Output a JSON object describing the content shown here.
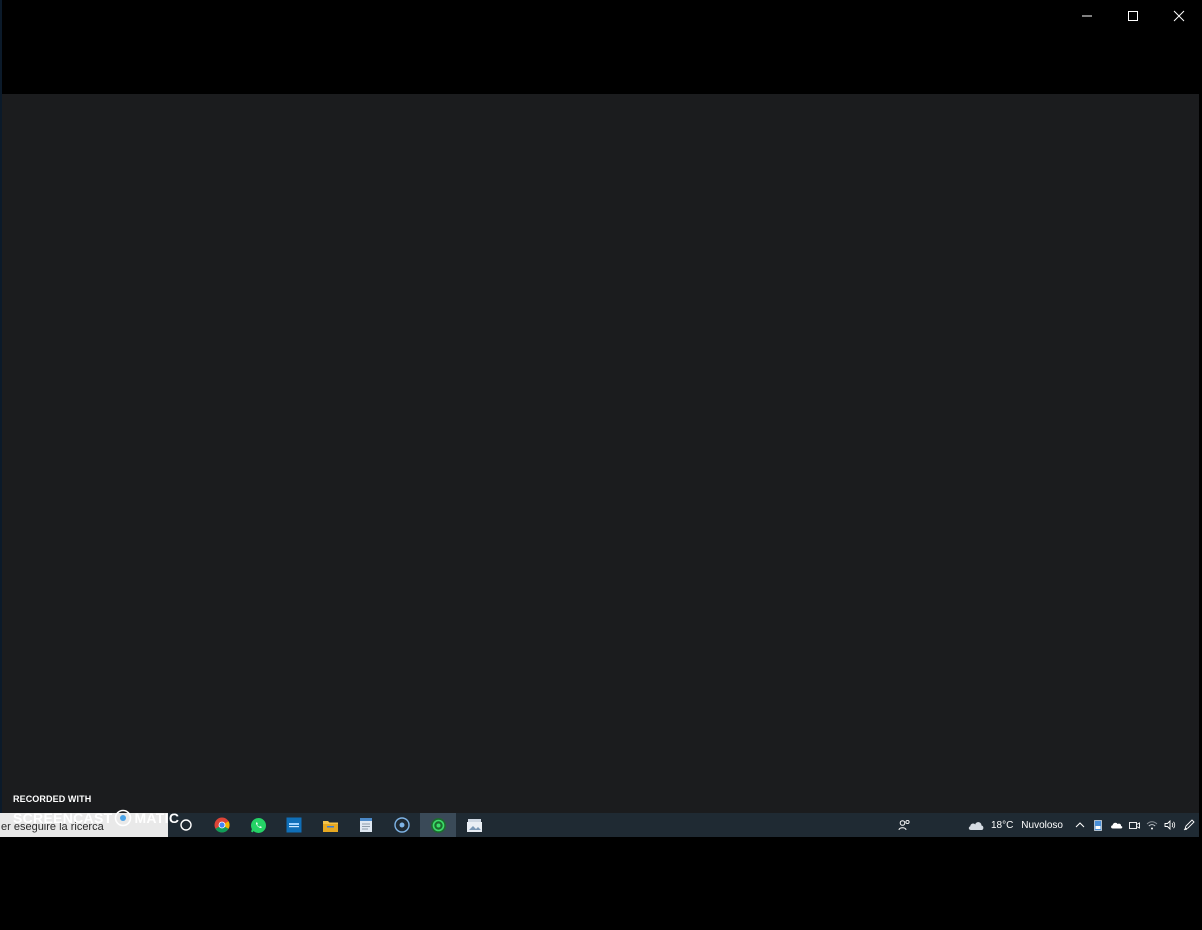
{
  "window": {
    "controls": {
      "minimize_icon": "minimize-icon",
      "maximize_icon": "maximize-icon",
      "close_icon": "close-icon"
    }
  },
  "watermark": {
    "line1": "RECORDED WITH",
    "brand_left": "SCREENCAST",
    "brand_right": "MATIC"
  },
  "taskbar": {
    "search_text": "er eseguire la ricerca",
    "apps": [
      {
        "name": "cortana-icon"
      },
      {
        "name": "chrome-icon"
      },
      {
        "name": "whatsapp-icon"
      },
      {
        "name": "intel-graphics-icon"
      },
      {
        "name": "file-explorer-icon"
      },
      {
        "name": "notepad-icon"
      },
      {
        "name": "screencast-o-matic-icon"
      },
      {
        "name": "recording-app-icon"
      },
      {
        "name": "photos-icon"
      }
    ],
    "tray": {
      "weather_temp": "18°C",
      "weather_desc": "Nuvoloso"
    }
  },
  "colors": {
    "content_bg": "#1b1c1e",
    "taskbar_bg": "#1f2a33",
    "screen_bg": "#000000"
  }
}
